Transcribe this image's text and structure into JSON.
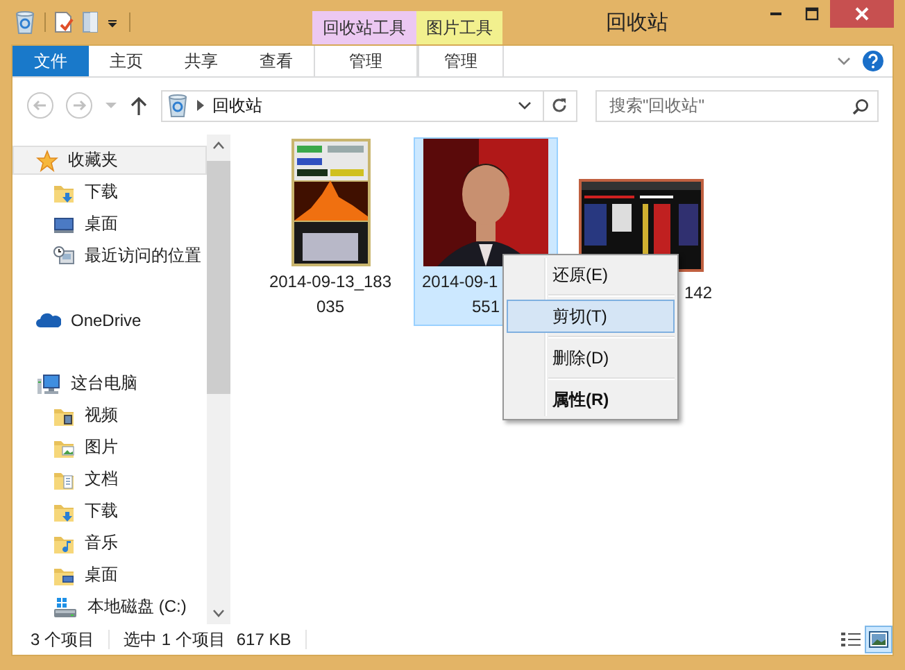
{
  "window": {
    "title": "回收站"
  },
  "ribbon": {
    "tabs": [
      {
        "label": "文件",
        "kind": "file",
        "selected": false
      },
      {
        "label": "主页",
        "kind": "tab",
        "selected": false
      },
      {
        "label": "共享",
        "kind": "tab",
        "selected": false
      },
      {
        "label": "查看",
        "kind": "tab",
        "selected": false
      }
    ],
    "tool_groups": [
      {
        "label": "回收站工具",
        "color": "#ecc8f2",
        "tabs": [
          {
            "label": "管理",
            "selected": false
          }
        ]
      },
      {
        "label": "图片工具",
        "color": "#f2f08e",
        "tabs": [
          {
            "label": "管理",
            "selected": false
          }
        ]
      }
    ]
  },
  "address_bar": {
    "path": [
      "回收站"
    ],
    "search": {
      "placeholder": "搜索\"回收站\""
    }
  },
  "navigation": {
    "items": [
      {
        "label": "收藏夹",
        "kind": "star",
        "selected": true,
        "children": [
          {
            "label": "下载",
            "kind": "folder-download",
            "selected": false
          },
          {
            "label": "桌面",
            "kind": "monitor",
            "selected": false
          },
          {
            "label": "最近访问的位置",
            "kind": "recent",
            "selected": false
          }
        ]
      },
      {
        "label": "OneDrive",
        "kind": "cloud",
        "selected": false
      },
      {
        "label": "这台电脑",
        "kind": "computer",
        "selected": false,
        "children": [
          {
            "label": "视频",
            "kind": "folder-video",
            "selected": false
          },
          {
            "label": "图片",
            "kind": "folder-picture",
            "selected": false
          },
          {
            "label": "文档",
            "kind": "folder-document",
            "selected": false
          },
          {
            "label": "下载",
            "kind": "folder-download",
            "selected": false
          },
          {
            "label": "音乐",
            "kind": "folder-music",
            "selected": false
          },
          {
            "label": "桌面",
            "kind": "folder-desktop",
            "selected": false
          },
          {
            "label": "本地磁盘 (C:)",
            "kind": "drive",
            "selected": false
          }
        ]
      }
    ]
  },
  "files": [
    {
      "selected": false,
      "lines": [
        {
          "text": "2014-09-13_183",
          "cut_start": false,
          "cut_end": false
        },
        {
          "text": "035",
          "cut_start": false,
          "cut_end": false
        }
      ]
    },
    {
      "selected": true,
      "lines": [
        {
          "text": "2014-09-1",
          "cut_start": false,
          "cut_end": true
        },
        {
          "text": "551",
          "cut_start": false,
          "cut_end": false
        }
      ]
    },
    {
      "selected": false,
      "lines": [
        {
          "text": "142",
          "cut_start": true,
          "cut_end": false
        }
      ]
    }
  ],
  "context_menu": {
    "items": [
      {
        "label": "还原(E)",
        "selected": false,
        "default": false
      },
      {
        "label": "剪切(T)",
        "selected": true,
        "default": false
      },
      {
        "label": "删除(D)",
        "selected": false,
        "default": false
      },
      {
        "label": "属性(R)",
        "selected": false,
        "default": true
      }
    ]
  },
  "status_bar": {
    "item_count": "3 个项目",
    "selection": "选中 1 个项目",
    "size": "617 KB",
    "views": [
      {
        "kind": "details",
        "selected": false
      },
      {
        "kind": "large-icons",
        "selected": true
      }
    ]
  }
}
